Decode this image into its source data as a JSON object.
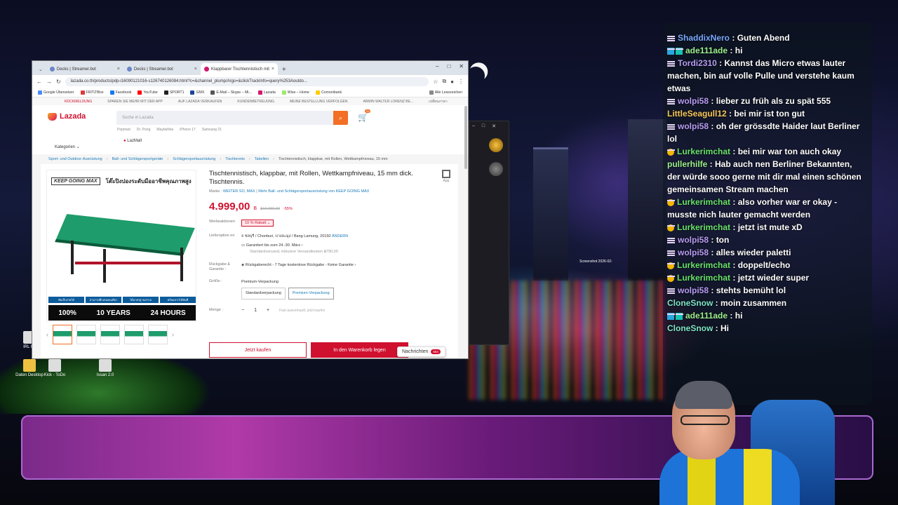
{
  "browser": {
    "tabs": [
      {
        "label": "Decks | Streamer.bot",
        "active": false
      },
      {
        "label": "Decks | Streamer.bot",
        "active": false
      },
      {
        "label": "Klappbarer Tischtennistisch mit",
        "active": true
      }
    ],
    "new_tab": "+",
    "url": "lazada.co.th/products/pdp-i16090121016-s126740126084.html?c=&channel_plump/Args=&clickTrackInfo=query%253Aoutdo...",
    "bookmarks": [
      "Google Übersetzer",
      "FRITZ!Box",
      "Facebook",
      "YouTube",
      "SPORT1",
      "GMX",
      "E-Mail – Skype – Mi...",
      "Lazada",
      "Wise – Home",
      "Comonibank"
    ],
    "bookmarks_right": "Alle Lesezeichen"
  },
  "lazada": {
    "topbar": [
      "RÜCKMELDUNG",
      "SPAREN SIE MEHR MIT DER APP",
      "AUF LAZADA VERKAUFEN",
      "KUNDENBETREUUNG",
      "MEINE BESTELLUNG VERFOLGEN",
      "ARMIN WALTER LORENZ BE...",
      "เปลี่ยนภาษา"
    ],
    "logo": "Lazada",
    "search_placeholder": "Suche in Lazada",
    "cart_count": "29",
    "suggestions": [
      "Popmart",
      "Dr. Pong",
      "Maybelline",
      "iPhone 17",
      "Samsung 21"
    ],
    "categories_label": "Kategorien",
    "lazmall": "LazMall",
    "breadcrumbs": [
      "Sport- und Outdoor-Ausrüstung",
      "Ball- und Schlägersportgeräte",
      "Schlägersportausrüstung",
      "Tischtennis",
      "Tabellen",
      "Tischtennistisch, klappbar, mit Rollen, Wettkampfniveau, 15 mm"
    ],
    "product": {
      "image_brand": "KEEP GOING MAX",
      "image_title": "โต๊ะปิงปองระดับมืออาชีพคุณภาพสูง",
      "image_features": [
        "พับเก็บง่ายได้",
        "สามารถฝึกเล่นคนเดียว",
        "ได้มาตรฐานสากล",
        "พร้อมลากได้ทันที"
      ],
      "image_footer": [
        "100%",
        "10 YEARS",
        "24 HOURS"
      ],
      "title": "Tischtennistisch, klappbar, mit Rollen, Wettkampfniveau, 15 mm dick. Tischtennis.",
      "brand_label": "Marke :",
      "brand": "WEITER SO, MAX",
      "brand_more": "Mehr Ball- und Schlägersportausrüstung von KEEP GOING MAX",
      "price": "4.999,00",
      "currency": "B",
      "old_price": "฿10.999,00",
      "discount": "-55%",
      "vouchers_label": "Werbeaktionen",
      "voucher": "10 % Rabatt",
      "delivery_label": "Lieferoption en",
      "delivery_address": "ชลบุรี / Chonburi, บางละมุง / Bang Lamung, 20150",
      "delivery_change": "ÄNDERN",
      "delivery_guarantee": "Garantiert bis zum 24.-30. März",
      "delivery_standard": "Standardversand, inklusive Versandkosten ฿790,00",
      "return_label": "Rückgabe & Garantie :",
      "return_text": "Rückgaberecht - 7 Tage kostenlose Rückgabe - Keine Garantie",
      "size_label": "Größe :",
      "size_selected": "Premium-Verpackung",
      "size_options": [
        "Standardverpackung",
        "Premium-Verpackung"
      ],
      "qty_label": "Menge :",
      "qty": "1",
      "qty_hint": "Fast ausverkauft, jetzt kaufen",
      "buy_now": "Jetzt kaufen",
      "add_to_cart": "In den Warenkorb legen",
      "app_label": "App"
    },
    "messages_label": "Nachrichten",
    "messages_count": "564"
  },
  "desktop": {
    "icons": [
      "IRL Fe",
      "Daten Desktop",
      "Kick - ToDo",
      "Issan 2.0"
    ],
    "screenshot": "Screenshot 2026-02-"
  },
  "chat": [
    {
      "user": "ShaddixNero",
      "text": "Guten Abend",
      "color": "u-blue",
      "badge": "sub"
    },
    {
      "user": "ade111ade",
      "text": "hi",
      "color": "u-lime",
      "badge": "bb"
    },
    {
      "user": "Tordi2310",
      "text": "Kannst das Micro etwas lauter machen, bin auf volle Pulle und verstehe kaum etwas",
      "color": "u-purple",
      "badge": "sub"
    },
    {
      "user": "wolpi58",
      "text": "lieber zu früh als zu spät 555",
      "color": "u-purple",
      "badge": "sub"
    },
    {
      "user": "LittleSeagull12",
      "text": "bei mir ist ton gut",
      "color": "u-orange",
      "badge": ""
    },
    {
      "user": "wolpi58",
      "text": "oh der grössdte Haider laut Berliner lol",
      "color": "u-purple",
      "badge": "sub"
    },
    {
      "user": "Lurkerimchat",
      "text": "bei mir war ton auch okay",
      "color": "u-green",
      "badge": "y"
    },
    {
      "user": "pullerhilfe",
      "text": "Hab auch nen Berliner Bekannten, der würde sooo gerne mit dir mal einen schönen gemeinsamen Stream machen",
      "color": "u-lime",
      "badge": ""
    },
    {
      "user": "Lurkerimchat",
      "text": "also vorher war er okay - musste nich lauter gemacht werden",
      "color": "u-green",
      "badge": "y"
    },
    {
      "user": "Lurkerimchat",
      "text": "jetzt ist mute xD",
      "color": "u-green",
      "badge": "y"
    },
    {
      "user": "wolpi58",
      "text": "ton",
      "color": "u-purple",
      "badge": "sub"
    },
    {
      "user": "wolpi58",
      "text": "alles wieder paletti",
      "color": "u-purple",
      "badge": "sub"
    },
    {
      "user": "Lurkerimchat",
      "text": "doppelt/echo",
      "color": "u-green",
      "badge": "y"
    },
    {
      "user": "Lurkerimchat",
      "text": "jetzt wieder super",
      "color": "u-green",
      "badge": "y"
    },
    {
      "user": "wolpi58",
      "text": "stehts bemüht lol",
      "color": "u-purple",
      "badge": "sub"
    },
    {
      "user": "CloneSnow",
      "text": "moin zusammen",
      "color": "u-teal",
      "badge": ""
    },
    {
      "user": "ade111ade",
      "text": "hi",
      "color": "u-lime",
      "badge": "bb"
    },
    {
      "user": "CloneSnow",
      "text": "Hi",
      "color": "u-teal",
      "badge": ""
    }
  ]
}
